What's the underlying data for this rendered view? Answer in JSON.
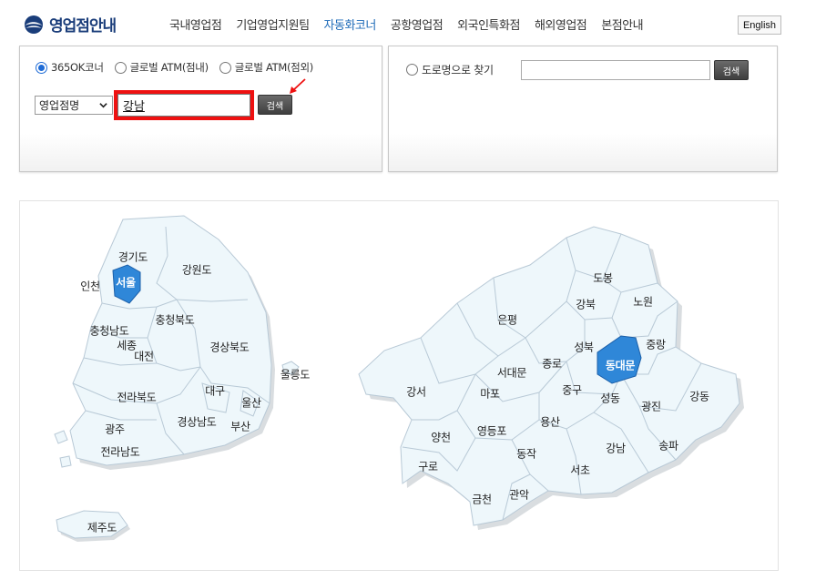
{
  "header": {
    "logo_text": "영업점안내",
    "nav": [
      {
        "label": "국내영업점",
        "active": false
      },
      {
        "label": "기업영업지원팀",
        "active": false
      },
      {
        "label": "자동화코너",
        "active": true
      },
      {
        "label": "공항영업점",
        "active": false
      },
      {
        "label": "외국인특화점",
        "active": false
      },
      {
        "label": "해외영업점",
        "active": false
      },
      {
        "label": "본점안내",
        "active": false
      }
    ],
    "lang_button": "English"
  },
  "search_left": {
    "radios": [
      {
        "label": "365OK코너",
        "checked": true
      },
      {
        "label": "글로벌 ATM(점내)",
        "checked": false
      },
      {
        "label": "글로벌 ATM(점외)",
        "checked": false
      }
    ],
    "select_value": "영업점명",
    "search_value": "강남",
    "search_button": "검색"
  },
  "search_right": {
    "radio_label": "도로명으로 찾기",
    "search_value": "",
    "search_button": "검색"
  },
  "korea_map": {
    "regions": [
      "경기도",
      "강원도",
      "인천",
      "서울",
      "충청북도",
      "충청남도",
      "세종",
      "대전",
      "경상북도",
      "울릉도",
      "대구",
      "전라북도",
      "울산",
      "경상남도",
      "부산",
      "광주",
      "전라남도",
      "제주도"
    ],
    "selected": "서울"
  },
  "seoul_map": {
    "districts": [
      "도봉",
      "노원",
      "강북",
      "은평",
      "성북",
      "중랑",
      "종로",
      "서대문",
      "동대문",
      "강서",
      "마포",
      "중구",
      "성동",
      "광진",
      "강동",
      "양천",
      "영등포",
      "용산",
      "강남",
      "송파",
      "구로",
      "동작",
      "서초",
      "금천",
      "관악"
    ],
    "selected": "동대문"
  },
  "colors": {
    "accent": "#1e6bb8",
    "highlight_border": "#ee1111",
    "region_fill": "#eef7fb",
    "selected_fill": "#2f87d8"
  }
}
